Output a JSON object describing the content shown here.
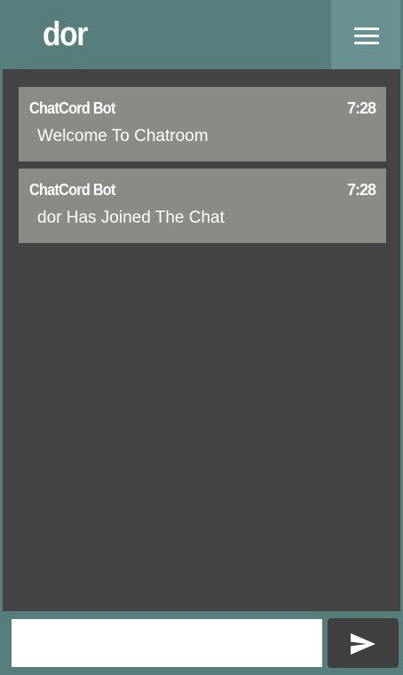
{
  "header": {
    "room_name": "dor",
    "menu_icon": "hamburger-menu-icon"
  },
  "messages": [
    {
      "username": "ChatCord Bot",
      "time": "7:28",
      "text": "Welcome To Chatroom"
    },
    {
      "username": "ChatCord Bot",
      "time": "7:28",
      "text": "dor Has Joined The Chat"
    }
  ],
  "composer": {
    "input_value": "",
    "send_icon": "send-icon"
  },
  "colors": {
    "accent": "#577d7d",
    "accent_light": "#6a9191",
    "background": "#444444",
    "message_bg": "#8c8a85",
    "send_button_bg": "#404040"
  }
}
